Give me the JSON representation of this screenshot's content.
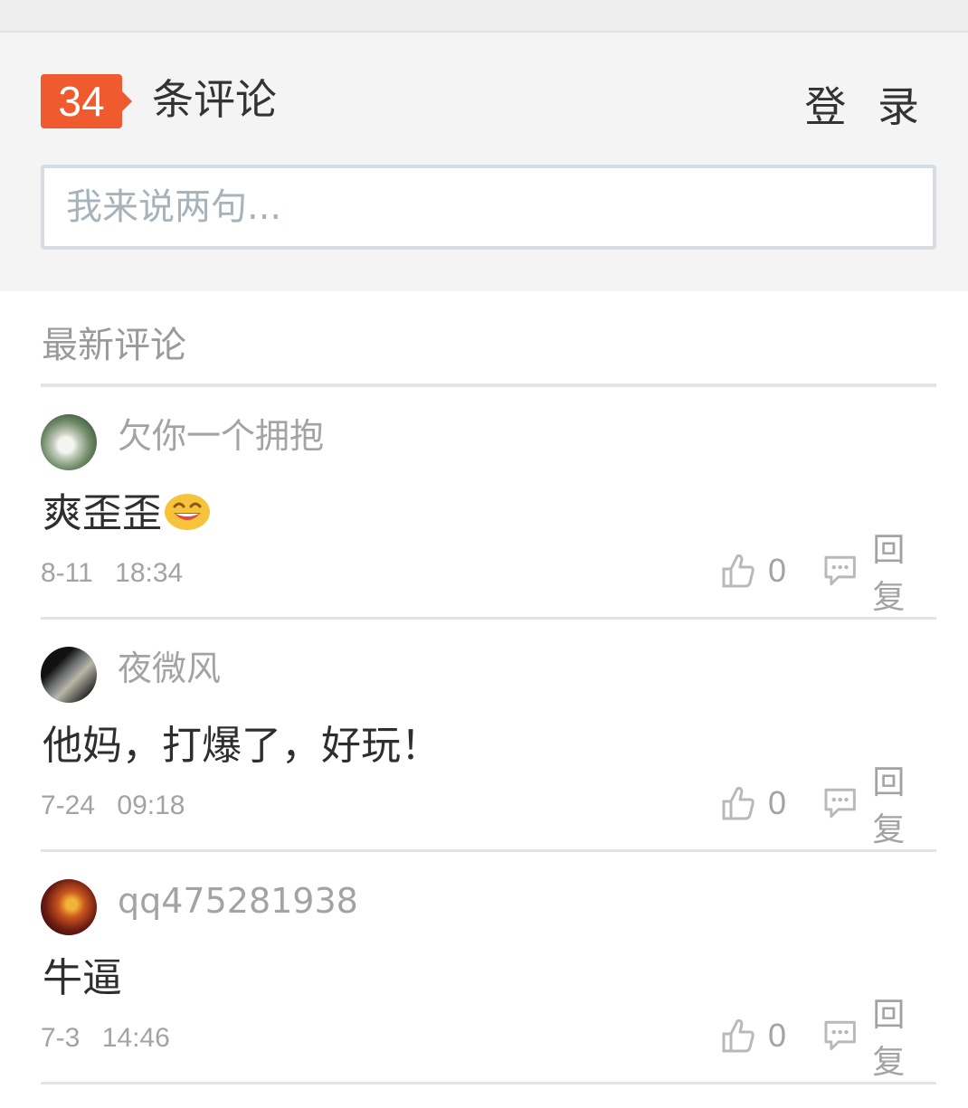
{
  "header": {
    "comment_count": "34",
    "count_label": "条评论",
    "login_label": "登 录"
  },
  "input": {
    "placeholder": "我来说两句..."
  },
  "section": {
    "title": "最新评论"
  },
  "comments": [
    {
      "username": "欠你一个拥抱",
      "content": "爽歪歪",
      "emoji": "grinning-face-emoji",
      "timestamp": "8-11 18:34",
      "likes": "0",
      "reply_label": "回复"
    },
    {
      "username": "夜微风",
      "content": "他妈，打爆了，好玩！",
      "timestamp": "7-24 09:18",
      "likes": "0",
      "reply_label": "回复"
    },
    {
      "username": "qq475281938",
      "content": "牛逼",
      "timestamp": "7-3 14:46",
      "likes": "0",
      "reply_label": "回复"
    }
  ],
  "colors": {
    "badge": "#ef5a2f",
    "header_bg": "#f4f4f4",
    "input_border": "#d5dde3",
    "muted_text": "#a3a3a3"
  },
  "icons": {
    "like": "thumbs-up-icon",
    "reply": "comment-bubble-icon"
  }
}
